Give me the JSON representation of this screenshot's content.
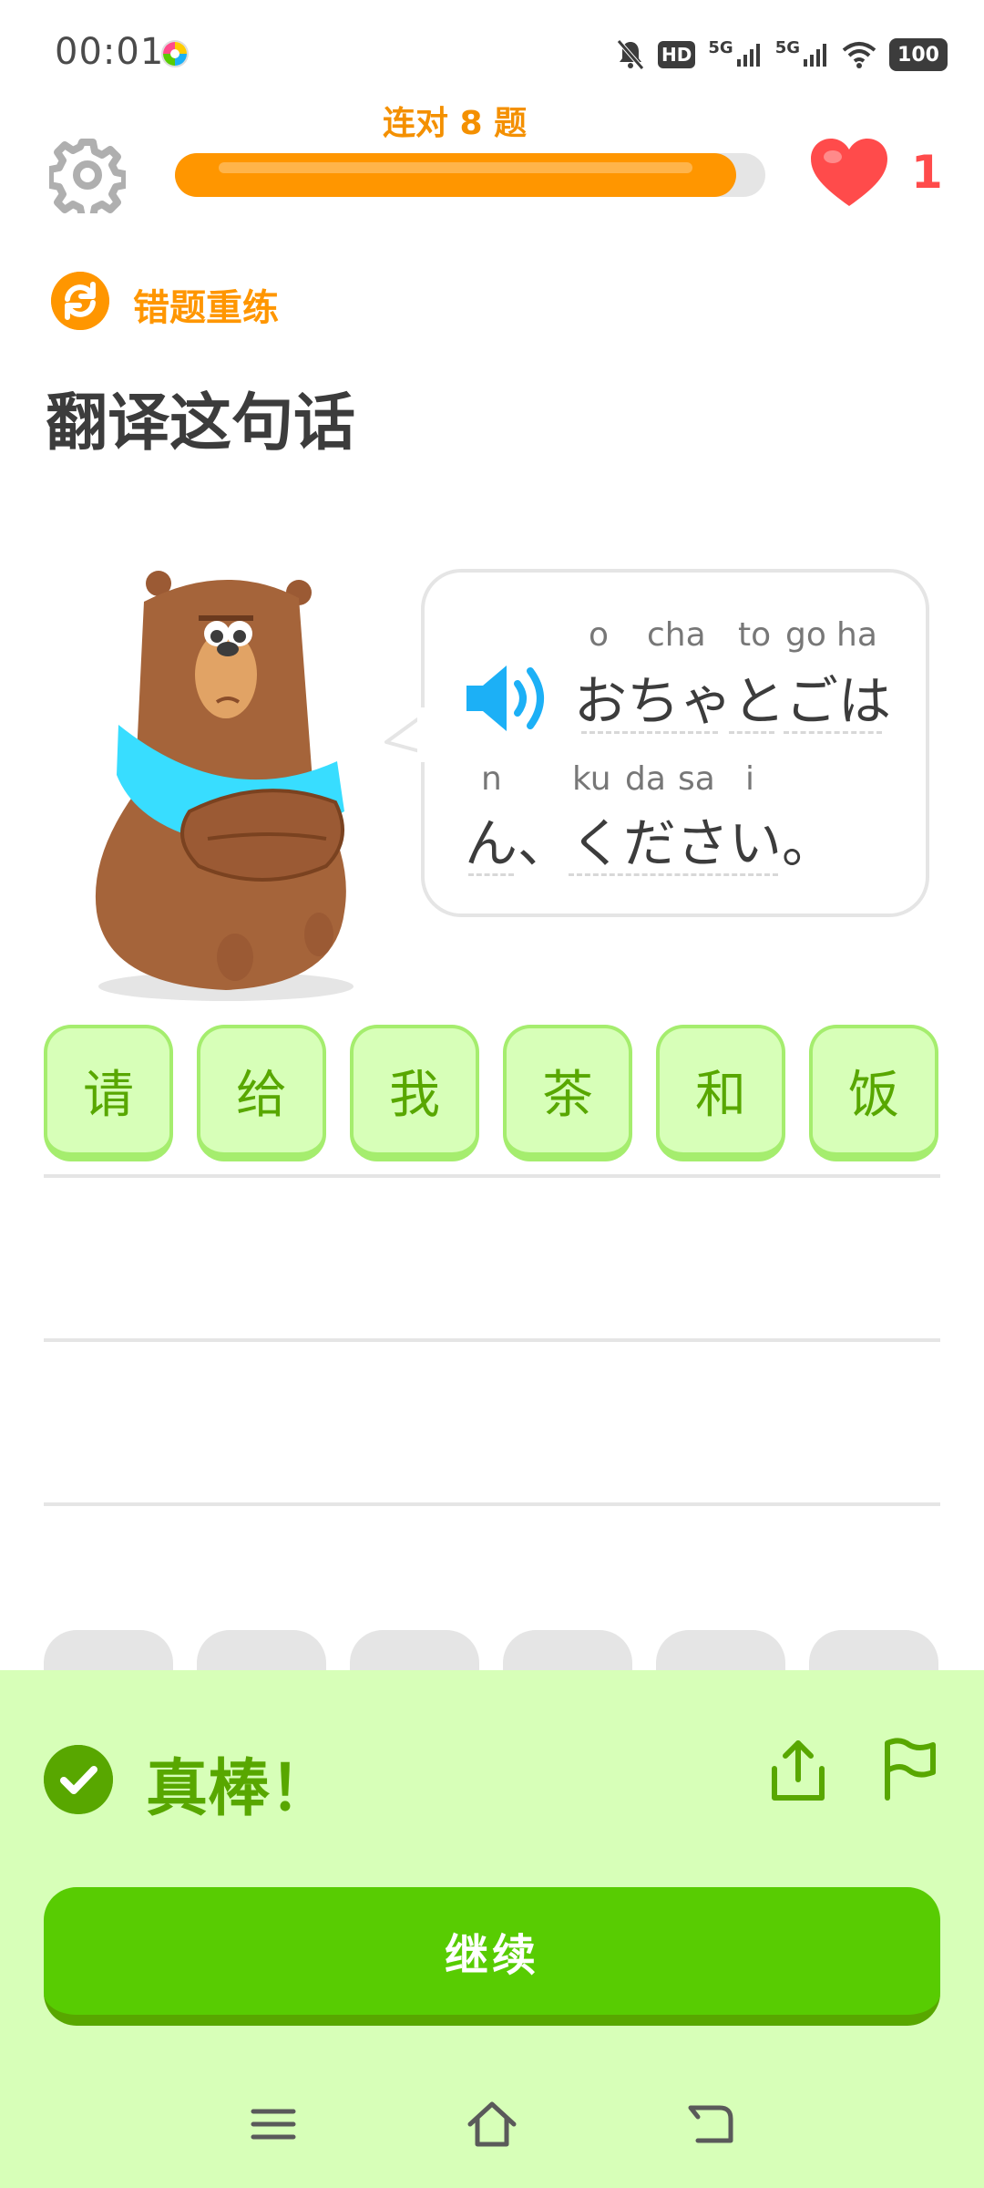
{
  "status_bar": {
    "time": "00:01",
    "network_hd": "HD",
    "sim1": "5G",
    "sim2": "5G",
    "battery": "100"
  },
  "header": {
    "streak_label": "连对 8 题",
    "progress": 0.95,
    "hearts": "1"
  },
  "lesson": {
    "review_label": "错题重练",
    "instruction": "翻译这句话"
  },
  "prompt": {
    "furigana_line1": [
      "o",
      "cha",
      "to",
      "go",
      "ha"
    ],
    "text_line1": "おちゃとごは",
    "furigana_line2": [
      "n",
      "ku",
      "da",
      "sa",
      "i"
    ],
    "text_line2": "ん、ください。"
  },
  "answer_words": [
    "请",
    "给",
    "我",
    "茶",
    "和",
    "饭"
  ],
  "feedback": {
    "message": "真棒！",
    "continue_label": "继续"
  },
  "icons": {
    "settings": "gear-icon",
    "hearts": "heart-icon",
    "review": "refresh-icon",
    "audio": "speaker-icon",
    "correct": "check-icon",
    "share": "share-icon",
    "report": "flag-icon"
  },
  "colors": {
    "orange": "#ff9600",
    "green": "#58cc02",
    "dark_green": "#58a700",
    "light_green": "#d7ffb8",
    "red": "#ff4b4b",
    "blue": "#1cb0f6"
  }
}
